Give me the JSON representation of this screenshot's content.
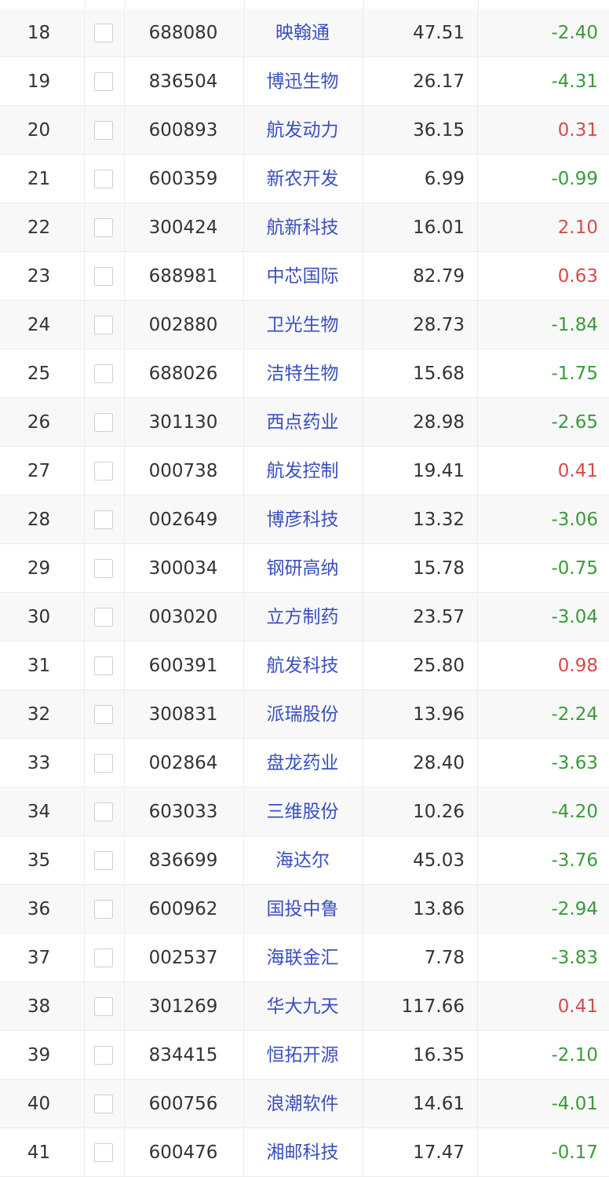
{
  "colors": {
    "up": "#d84a4a",
    "down": "#3a9a3a",
    "name_link": "#3a4fbf"
  },
  "rows": [
    {
      "idx": "18",
      "code": "688080",
      "name": "映翰通",
      "price": "47.51",
      "change": "-2.40"
    },
    {
      "idx": "19",
      "code": "836504",
      "name": "博迅生物",
      "price": "26.17",
      "change": "-4.31"
    },
    {
      "idx": "20",
      "code": "600893",
      "name": "航发动力",
      "price": "36.15",
      "change": "0.31"
    },
    {
      "idx": "21",
      "code": "600359",
      "name": "新农开发",
      "price": "6.99",
      "change": "-0.99"
    },
    {
      "idx": "22",
      "code": "300424",
      "name": "航新科技",
      "price": "16.01",
      "change": "2.10"
    },
    {
      "idx": "23",
      "code": "688981",
      "name": "中芯国际",
      "price": "82.79",
      "change": "0.63"
    },
    {
      "idx": "24",
      "code": "002880",
      "name": "卫光生物",
      "price": "28.73",
      "change": "-1.84"
    },
    {
      "idx": "25",
      "code": "688026",
      "name": "洁特生物",
      "price": "15.68",
      "change": "-1.75"
    },
    {
      "idx": "26",
      "code": "301130",
      "name": "西点药业",
      "price": "28.98",
      "change": "-2.65"
    },
    {
      "idx": "27",
      "code": "000738",
      "name": "航发控制",
      "price": "19.41",
      "change": "0.41"
    },
    {
      "idx": "28",
      "code": "002649",
      "name": "博彦科技",
      "price": "13.32",
      "change": "-3.06"
    },
    {
      "idx": "29",
      "code": "300034",
      "name": "钢研高纳",
      "price": "15.78",
      "change": "-0.75"
    },
    {
      "idx": "30",
      "code": "003020",
      "name": "立方制药",
      "price": "23.57",
      "change": "-3.04"
    },
    {
      "idx": "31",
      "code": "600391",
      "name": "航发科技",
      "price": "25.80",
      "change": "0.98"
    },
    {
      "idx": "32",
      "code": "300831",
      "name": "派瑞股份",
      "price": "13.96",
      "change": "-2.24"
    },
    {
      "idx": "33",
      "code": "002864",
      "name": "盘龙药业",
      "price": "28.40",
      "change": "-3.63"
    },
    {
      "idx": "34",
      "code": "603033",
      "name": "三维股份",
      "price": "10.26",
      "change": "-4.20"
    },
    {
      "idx": "35",
      "code": "836699",
      "name": "海达尔",
      "price": "45.03",
      "change": "-3.76"
    },
    {
      "idx": "36",
      "code": "600962",
      "name": "国投中鲁",
      "price": "13.86",
      "change": "-2.94"
    },
    {
      "idx": "37",
      "code": "002537",
      "name": "海联金汇",
      "price": "7.78",
      "change": "-3.83"
    },
    {
      "idx": "38",
      "code": "301269",
      "name": "华大九天",
      "price": "117.66",
      "change": "0.41"
    },
    {
      "idx": "39",
      "code": "834415",
      "name": "恒拓开源",
      "price": "16.35",
      "change": "-2.10"
    },
    {
      "idx": "40",
      "code": "600756",
      "name": "浪潮软件",
      "price": "14.61",
      "change": "-4.01"
    },
    {
      "idx": "41",
      "code": "600476",
      "name": "湘邮科技",
      "price": "17.47",
      "change": "-0.17"
    }
  ]
}
